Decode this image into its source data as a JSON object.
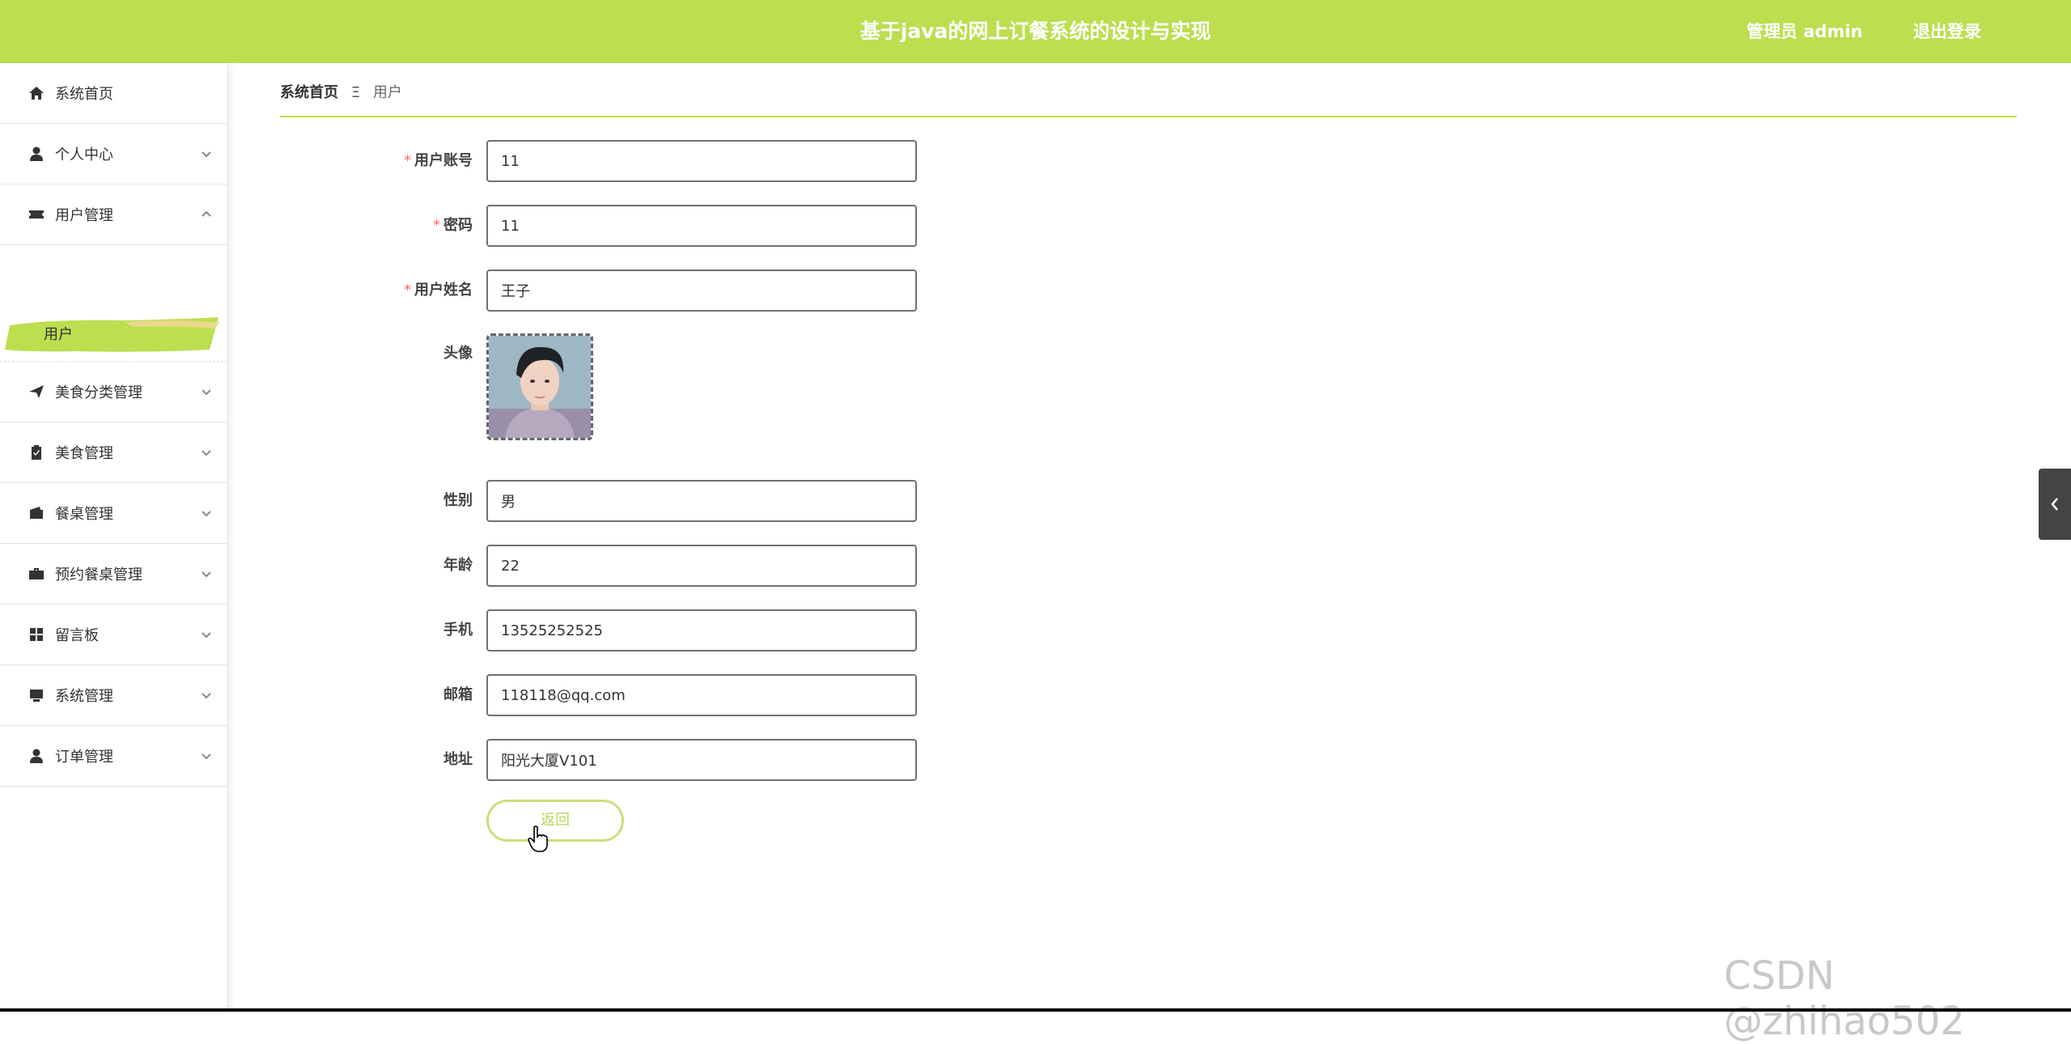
{
  "header": {
    "title": "基于java的网上订餐系统的设计与实现",
    "user": "管理员 admin",
    "logout": "退出登录"
  },
  "sidebar": {
    "items": [
      {
        "label": "系统首页",
        "icon": "home-icon"
      },
      {
        "label": "个人中心",
        "icon": "user-icon"
      },
      {
        "label": "用户管理",
        "icon": "ticket-icon"
      },
      {
        "label": "美食分类管理",
        "icon": "send-icon"
      },
      {
        "label": "美食管理",
        "icon": "clipboard-icon"
      },
      {
        "label": "餐桌管理",
        "icon": "wallet-icon"
      },
      {
        "label": "预约餐桌管理",
        "icon": "briefcase-icon"
      },
      {
        "label": "留言板",
        "icon": "grid-icon"
      },
      {
        "label": "系统管理",
        "icon": "monitor-icon"
      },
      {
        "label": "订单管理",
        "icon": "user-icon"
      }
    ],
    "submenu_label": "用户",
    "accent": "#bcde4f"
  },
  "breadcrumb": {
    "home": "系统首页",
    "separator": "Ξ",
    "current": "用户"
  },
  "form": {
    "account_label": "用户账号",
    "account_value": "11",
    "password_label": "密码",
    "password_value": "11",
    "name_label": "用户姓名",
    "name_value": "王子",
    "avatar_label": "头像",
    "gender_label": "性别",
    "gender_value": "男",
    "age_label": "年龄",
    "age_value": "22",
    "phone_label": "手机",
    "phone_value": "13525252525",
    "email_label": "邮箱",
    "email_value": "118118@qq.com",
    "address_label": "地址",
    "address_value": "阳光大厦V101",
    "back_label": "返回"
  },
  "watermark": "CSDN @zhihao502"
}
